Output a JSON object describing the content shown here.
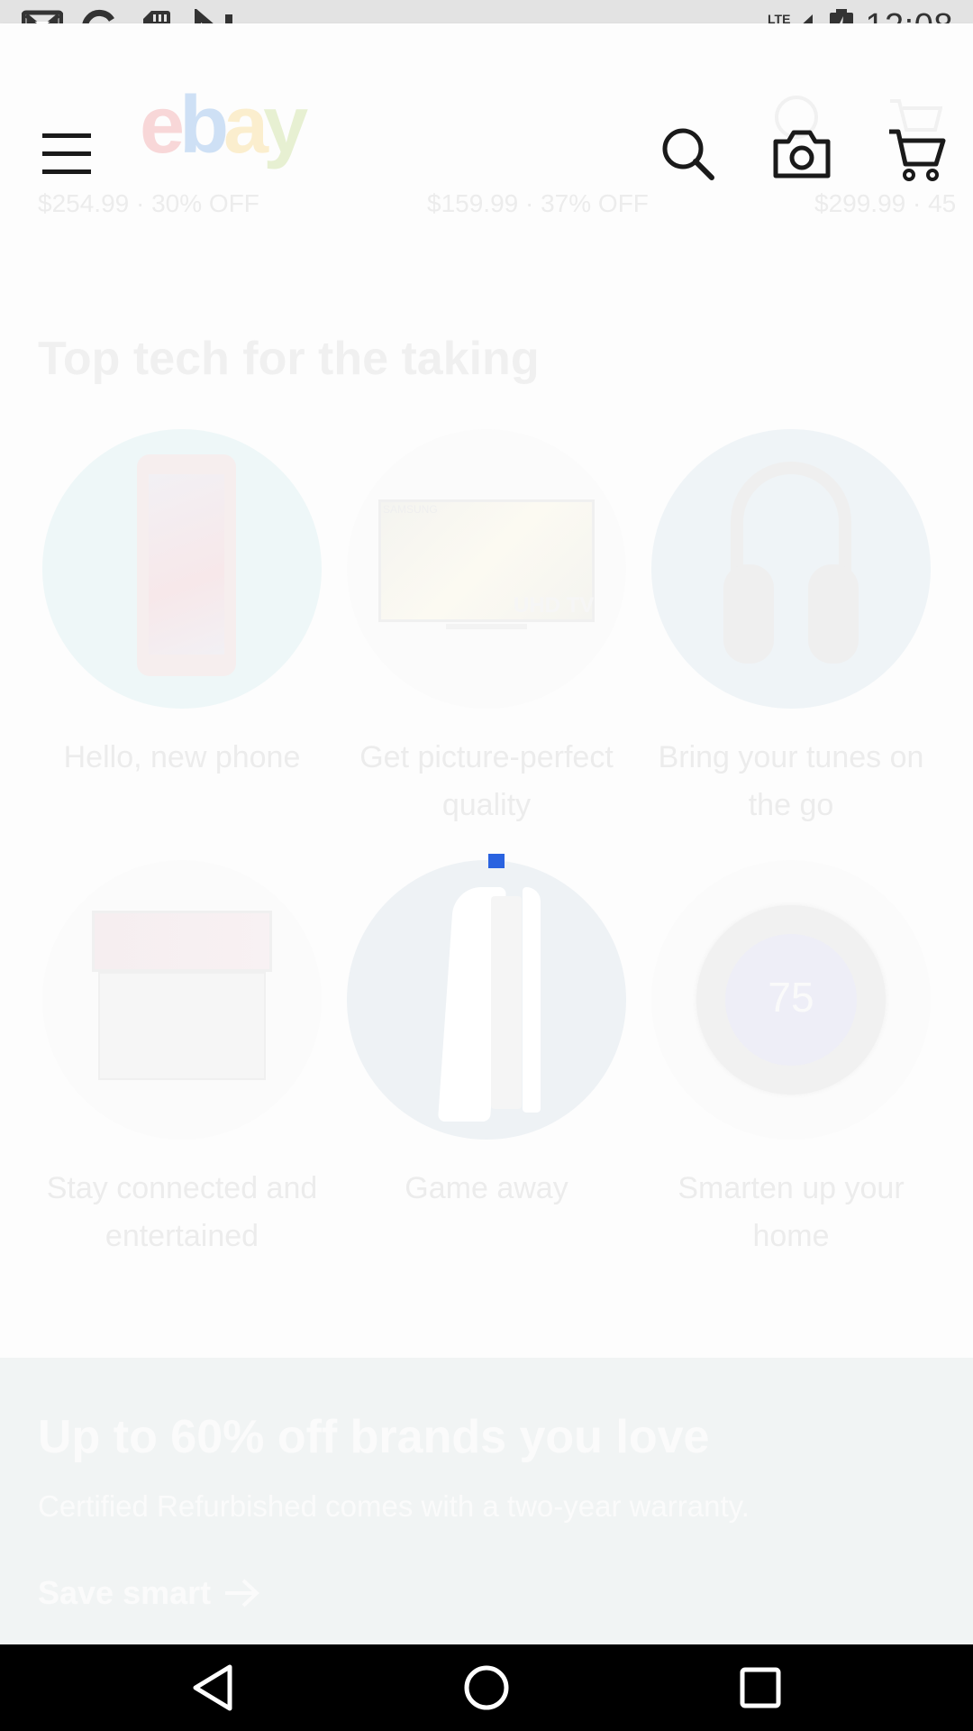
{
  "status_bar": {
    "time": "12:08",
    "network": "LTE",
    "notification_icons": [
      "gmail-icon",
      "google-icon",
      "sd-card-icon",
      "n-icon"
    ],
    "system_icons": [
      "lte-signal-icon",
      "battery-charging-icon"
    ]
  },
  "header": {
    "logo_letters": [
      "e",
      "b",
      "a",
      "y"
    ],
    "ghost_prices": [
      "$254.99 · 30% OFF",
      "$159.99 · 37% OFF",
      "$299.99 · 45"
    ],
    "icons": [
      "menu-icon",
      "search-icon",
      "camera-icon",
      "cart-icon"
    ]
  },
  "section": {
    "title": "Top tech for the taking",
    "categories": [
      {
        "label": "Hello, new phone",
        "icon": "phone-image"
      },
      {
        "label": "Get picture-perfect quality",
        "icon": "tv-image"
      },
      {
        "label": "Bring your tunes on the go",
        "icon": "headphones-image"
      },
      {
        "label": "Stay connected and entertained",
        "icon": "laptop-image"
      },
      {
        "label": "Game away",
        "icon": "console-image"
      },
      {
        "label": "Smarten up your home",
        "icon": "thermostat-image"
      }
    ],
    "tv_brand": "SAMSUNG",
    "tv_badge": "UHD TV",
    "thermostat_reading": "75"
  },
  "promo": {
    "title": "Up to 60% off brands you love",
    "subtitle": "Certified Refurbished comes with a two-year warranty.",
    "link": "Save smart"
  },
  "colors": {
    "accent_blue": "#2a63e0",
    "ebay_red": "#e53238",
    "ebay_blue": "#0064d2",
    "ebay_yellow": "#f5af02",
    "ebay_green": "#86b817"
  }
}
